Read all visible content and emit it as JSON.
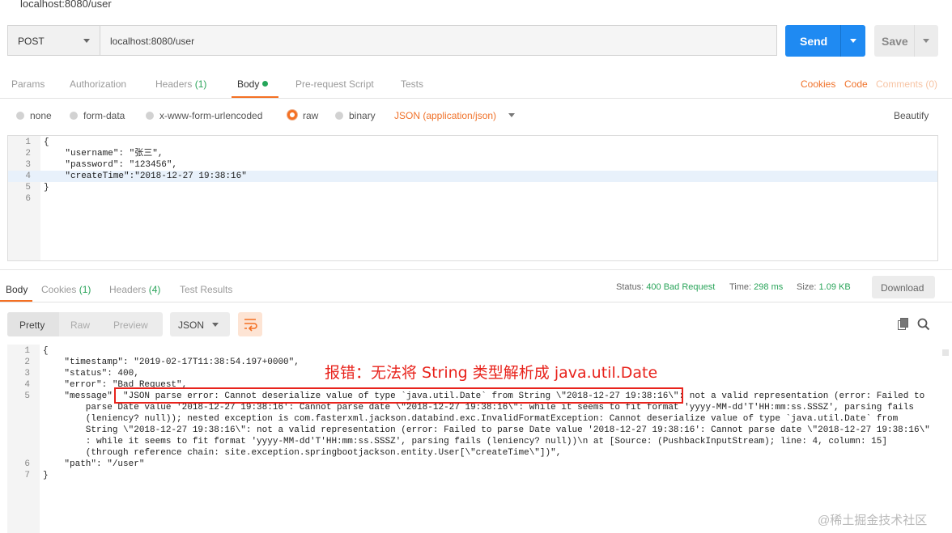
{
  "window": {
    "title": "localhost:8080/user"
  },
  "request": {
    "method": "POST",
    "url": "localhost:8080/user",
    "send_label": "Send",
    "save_label": "Save"
  },
  "request_tabs": {
    "params": "Params",
    "authorization": "Authorization",
    "headers": "Headers",
    "headers_count": "(1)",
    "body": "Body",
    "prerequest": "Pre-request Script",
    "tests": "Tests",
    "cookies": "Cookies",
    "code": "Code",
    "comments": "Comments (0)"
  },
  "body_types": {
    "none": "none",
    "form_data": "form-data",
    "urlencoded": "x-www-form-urlencoded",
    "raw": "raw",
    "binary": "binary",
    "content_type": "JSON (application/json)",
    "beautify": "Beautify",
    "selected": "raw"
  },
  "request_body_lines": [
    {
      "n": "1",
      "text": "{"
    },
    {
      "n": "2",
      "text": "    \"username\": \"张三\","
    },
    {
      "n": "3",
      "text": "    \"password\": \"123456\","
    },
    {
      "n": "4",
      "text": "    \"createTime\":\"2018-12-27 19:38:16\""
    },
    {
      "n": "5",
      "text": "}"
    },
    {
      "n": "6",
      "text": ""
    }
  ],
  "response_tabs": {
    "body": "Body",
    "cookies": "Cookies",
    "cookies_count": "(1)",
    "headers": "Headers",
    "headers_count": "(4)",
    "test_results": "Test Results"
  },
  "response_status": {
    "status_label": "Status:",
    "status_value": "400 Bad Request",
    "time_label": "Time:",
    "time_value": "298 ms",
    "size_label": "Size:",
    "size_value": "1.09 KB",
    "download": "Download"
  },
  "response_toolbar": {
    "pretty": "Pretty",
    "raw": "Raw",
    "preview": "Preview",
    "format": "JSON"
  },
  "response_body_lines": [
    {
      "n": "1",
      "text": "{"
    },
    {
      "n": "2",
      "text": "    \"timestamp\": \"2019-02-17T11:38:54.197+0000\","
    },
    {
      "n": "3",
      "text": "    \"status\": 400,"
    },
    {
      "n": "4",
      "text": "    \"error\": \"Bad Request\","
    },
    {
      "n": "5",
      "text": "    \"message\": \"JSON parse error: Cannot deserialize value of type `java.util.Date` from String \\\"2018-12-27 19:38:16\\\": not a valid representation (error: Failed to"
    },
    {
      "n": "",
      "text": "        parse Date value '2018-12-27 19:38:16': Cannot parse date \\\"2018-12-27 19:38:16\\\": while it seems to fit format 'yyyy-MM-dd'T'HH:mm:ss.SSSZ', parsing fails"
    },
    {
      "n": "",
      "text": "        (leniency? null)); nested exception is com.fasterxml.jackson.databind.exc.InvalidFormatException: Cannot deserialize value of type `java.util.Date` from"
    },
    {
      "n": "",
      "text": "        String \\\"2018-12-27 19:38:16\\\": not a valid representation (error: Failed to parse Date value '2018-12-27 19:38:16': Cannot parse date \\\"2018-12-27 19:38:16\\\""
    },
    {
      "n": "",
      "text": "        : while it seems to fit format 'yyyy-MM-dd'T'HH:mm:ss.SSSZ', parsing fails (leniency? null))\\n at [Source: (PushbackInputStream); line: 4, column: 15]"
    },
    {
      "n": "",
      "text": "        (through reference chain: site.exception.springbootjackson.entity.User[\\\"createTime\\\"])\","
    },
    {
      "n": "6",
      "text": "    \"path\": \"/user\""
    },
    {
      "n": "7",
      "text": "}"
    }
  ],
  "annotation": {
    "text": "报错：无法将 String 类型解析成 java.util.Date"
  },
  "watermark": "@稀土掘金技术社区",
  "colors": {
    "accent": "#f47023",
    "send": "#1f8af2",
    "ok_green": "#2aa45a",
    "annotation_red": "#e8231c"
  },
  "icons": [
    "chevron-down-icon",
    "wrap-lines-icon",
    "copy-icon",
    "search-icon"
  ]
}
